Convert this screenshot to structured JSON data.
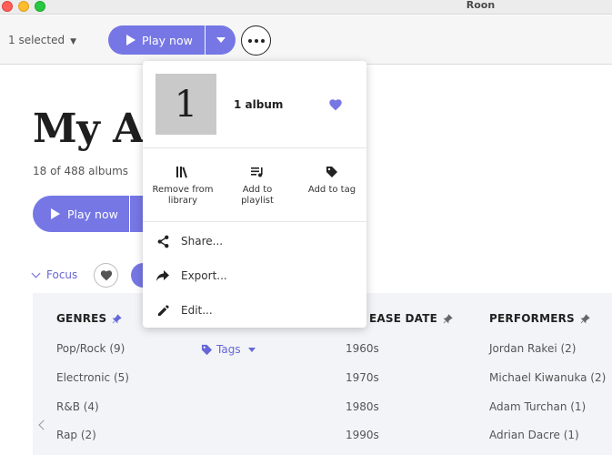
{
  "window": {
    "title": "Roon"
  },
  "toolbar": {
    "selected_label": "1 selected",
    "play_label": "Play now"
  },
  "main": {
    "title": "My A",
    "count": "18 of 488 albums",
    "play_label": "Play now",
    "focus_label": "Focus"
  },
  "popup": {
    "album_art_text": "1",
    "album_label": "1 album",
    "actions": [
      {
        "line1": "Remove from",
        "line2": "library",
        "icon": "library-icon"
      },
      {
        "line1": "Add to",
        "line2": "playlist",
        "icon": "playlist-add-icon"
      },
      {
        "line1": "Add to tag",
        "line2": "",
        "icon": "tag-icon"
      }
    ],
    "menu": [
      {
        "label": "Share...",
        "icon": "share-icon"
      },
      {
        "label": "Export...",
        "icon": "export-icon"
      },
      {
        "label": "Edit...",
        "icon": "edit-icon"
      }
    ]
  },
  "filters": {
    "genres_header": "GENRES",
    "release_header": "EASE DATE",
    "performers_header": "PERFORMERS",
    "tags_label": "Tags",
    "genres": [
      "Pop/Rock (9)",
      "Electronic (5)",
      "R&B (4)",
      "Rap (2)"
    ],
    "release_dates": [
      "1960s",
      "1970s",
      "1980s",
      "1990s"
    ],
    "performers": [
      "Jordan Rakei (2)",
      "Michael Kiwanuka (2)",
      "Adam Turchan (1)",
      "Adrian Dacre (1)"
    ]
  },
  "colors": {
    "accent": "#7677e5",
    "accent_text": "#6667d6",
    "panel_bg": "#f3f4f8"
  }
}
